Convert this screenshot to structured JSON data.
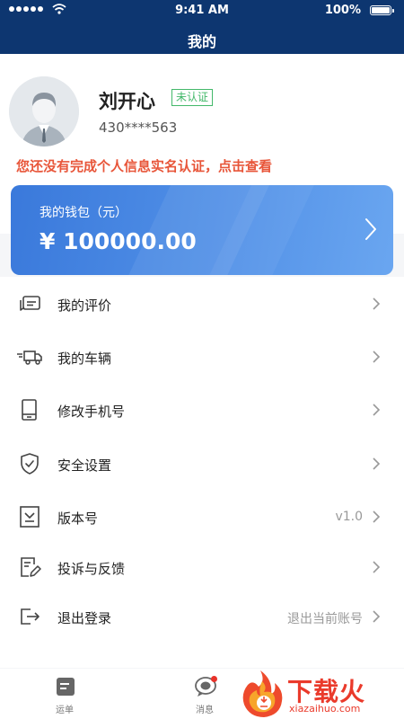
{
  "status_bar": {
    "time": "9:41 AM",
    "battery": "100%"
  },
  "header": {
    "title": "我的"
  },
  "profile": {
    "name": "刘开心",
    "verify_status": "未认证",
    "phone": "430****563",
    "notice": "您还没有完成个人信息实名认证，点击查看"
  },
  "wallet": {
    "label": "我的钱包（元）",
    "amount": "¥ 100000.00"
  },
  "menu": [
    {
      "label": "我的评价",
      "icon": "comment-icon"
    },
    {
      "label": "我的车辆",
      "icon": "truck-icon"
    },
    {
      "label": "修改手机号",
      "icon": "phone-icon"
    },
    {
      "label": "安全设置",
      "icon": "shield-icon"
    },
    {
      "label": "版本号",
      "value": "v1.0",
      "icon": "download-icon"
    },
    {
      "label": "投诉与反馈",
      "icon": "feedback-icon"
    },
    {
      "label": "退出登录",
      "value": "退出当前账号",
      "icon": "logout-icon"
    }
  ],
  "tabbar": [
    {
      "label": "运单",
      "icon": "waybill-icon"
    },
    {
      "label": "消息",
      "icon": "message-icon"
    }
  ],
  "watermark": {
    "text": "下载火",
    "subtext": "xiazaihuo.com"
  },
  "colors": {
    "header": "#0d3670",
    "accent": "#4f8ee6",
    "warning": "#e8563a",
    "verified_badge": "#43b86a",
    "badge": "#e8322a"
  }
}
